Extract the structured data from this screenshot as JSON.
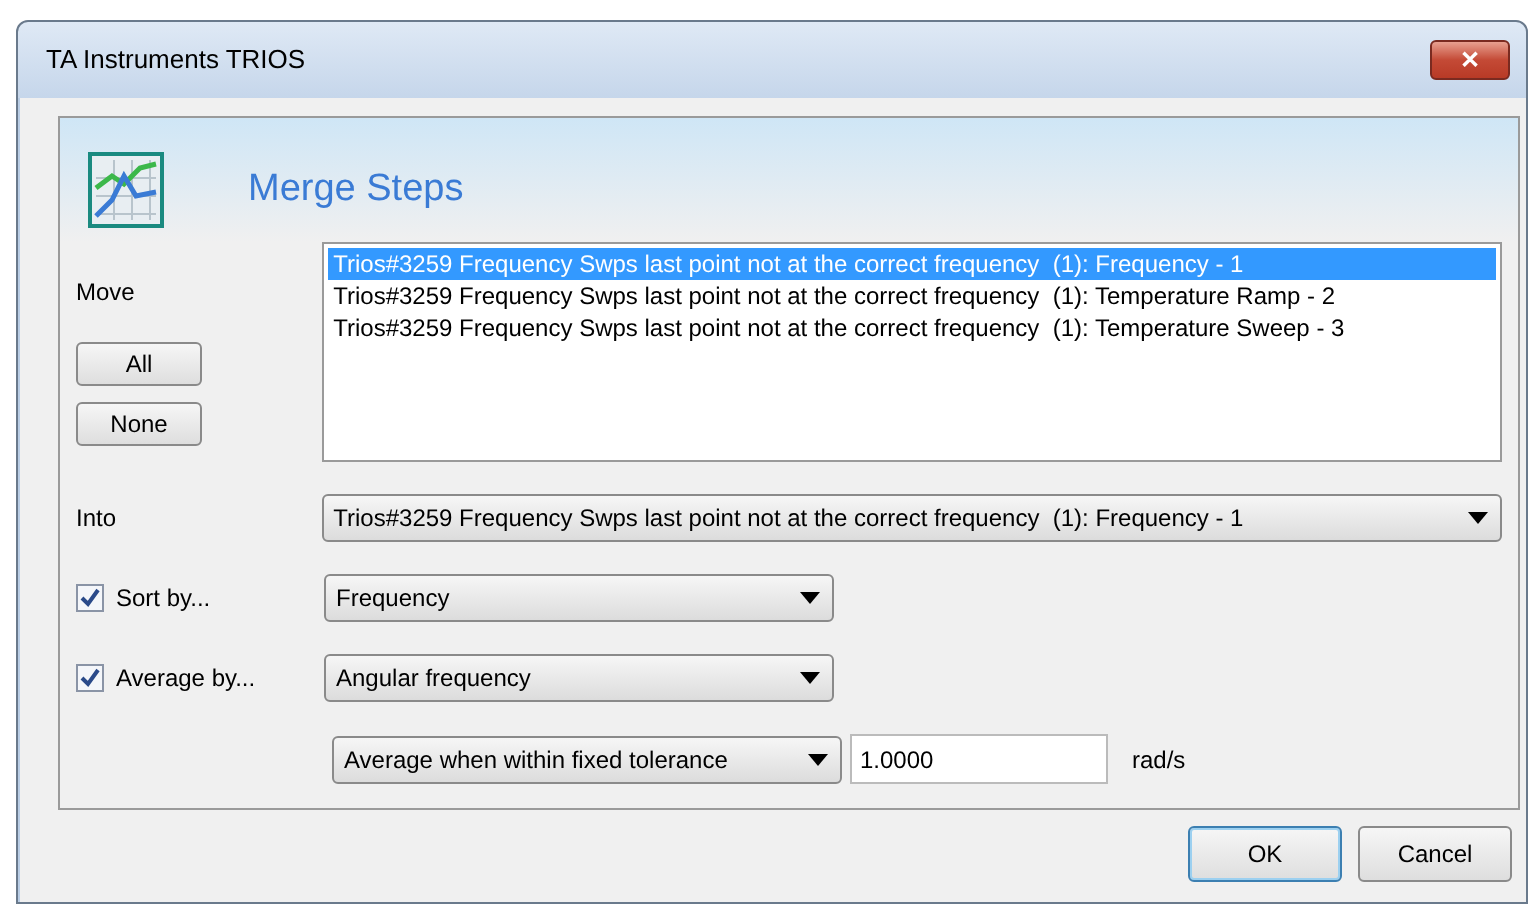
{
  "window": {
    "title": "TA Instruments TRIOS",
    "close": "✕"
  },
  "header": {
    "title": "Merge Steps"
  },
  "move": {
    "label": "Move",
    "buttons": [
      "All",
      "None"
    ]
  },
  "steps": [
    {
      "label": "Trios#3259 Frequency Swps last point not at the correct frequency  (1): Frequency - 1",
      "selected": true
    },
    {
      "label": "Trios#3259 Frequency Swps last point not at the correct frequency  (1): Temperature Ramp - 2",
      "selected": false
    },
    {
      "label": "Trios#3259 Frequency Swps last point not at the correct frequency  (1): Temperature Sweep - 3",
      "selected": false
    }
  ],
  "into": {
    "label": "Into",
    "value": "Trios#3259 Frequency Swps last point not at the correct frequency  (1): Frequency - 1"
  },
  "sort": {
    "label": "Sort by...",
    "checked": true,
    "value": "Frequency"
  },
  "average": {
    "label": "Average by...",
    "checked": true,
    "value": "Angular frequency"
  },
  "tolerance": {
    "mode": "Average when within fixed tolerance",
    "value": "1.0000",
    "unit": "rad/s"
  },
  "buttons": [
    {
      "label": "OK",
      "default": true
    },
    {
      "label": "Cancel",
      "default": false
    }
  ]
}
